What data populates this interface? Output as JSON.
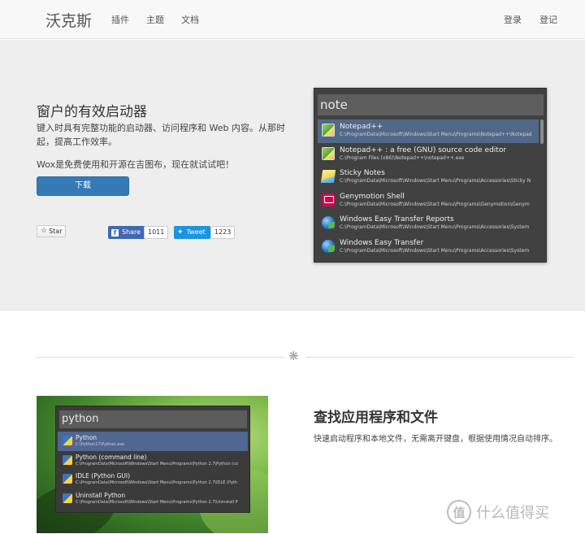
{
  "navbar": {
    "brand": "沃克斯",
    "left_links": [
      "插件",
      "主题",
      "文档"
    ],
    "right_links": [
      "登录",
      "登记"
    ]
  },
  "hero": {
    "title": "窗户的有效启动器",
    "description": "键入时具有完整功能的启动器、访问程序和 Web 内容。从那时起，提高工作效率。",
    "description2": "Wox是免费使用和开源在吉图布，现在就试试吧！",
    "download_label": "下载",
    "social": {
      "star_label": "Star",
      "share_label": "Share",
      "share_count": "1011",
      "tweet_label": "Tweet",
      "tweet_count": "1223"
    }
  },
  "launcher1": {
    "query": "note",
    "results": [
      {
        "title": "Notepad++",
        "subtitle": "C:\\ProgramData\\Microsoft\\Windows\\Start Menu\\Programs\\Notepad++\\Notepad",
        "icon": "notepad-icon",
        "selected": true
      },
      {
        "title": "Notepad++ : a free (GNU) source code editor",
        "subtitle": "C:\\Program Files (x86)\\Notepad++\\notepad++.exe",
        "icon": "notepad-icon",
        "selected": false
      },
      {
        "title": "Sticky Notes",
        "subtitle": "C:\\ProgramData\\Microsoft\\Windows\\Start Menu\\Programs\\Accessories\\Sticky N",
        "icon": "sticky-notes-icon",
        "selected": false
      },
      {
        "title": "Genymotion Shell",
        "subtitle": "C:\\ProgramData\\Microsoft\\Windows\\Start Menu\\Programs\\Genymotion\\Genym",
        "icon": "genymotion-icon",
        "selected": false
      },
      {
        "title": "Windows Easy Transfer Reports",
        "subtitle": "C:\\ProgramData\\Microsoft\\Windows\\Start Menu\\Programs\\Accessories\\System",
        "icon": "globe-icon",
        "selected": false
      },
      {
        "title": "Windows Easy Transfer",
        "subtitle": "C:\\ProgramData\\Microsoft\\Windows\\Start Menu\\Programs\\Accessories\\System",
        "icon": "globe-icon",
        "selected": false
      }
    ]
  },
  "feature": {
    "title": "查找应用程序和文件",
    "description": "快速启动程序和本地文件，无需离开键盘，根据使用情况自动排序。",
    "launcher": {
      "query": "python",
      "results": [
        {
          "title": "Python",
          "subtitle": "C:\\Python27\\Python.exe",
          "selected": true
        },
        {
          "title": "Python (command line)",
          "subtitle": "C:\\ProgramData\\Microsoft\\Windows\\Start Menu\\Programs\\Python 2.7\\Python (co",
          "selected": false
        },
        {
          "title": "IDLE (Python GUI)",
          "subtitle": "C:\\ProgramData\\Microsoft\\Windows\\Start Menu\\Programs\\Python 2.7\\IDLE (Pyth",
          "selected": false
        },
        {
          "title": "Uninstall Python",
          "subtitle": "C:\\ProgramData\\Microsoft\\Windows\\Start Menu\\Programs\\Python 2.7\\Uninstall P",
          "selected": false
        }
      ]
    }
  },
  "watermark": {
    "logo_glyph": "值",
    "text": "什么值得买"
  }
}
